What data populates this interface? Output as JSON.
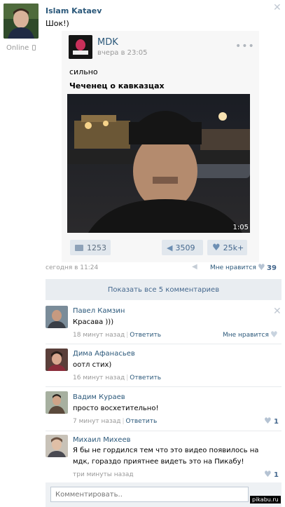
{
  "post": {
    "author": "Islam Kataev",
    "text": "Шок!)",
    "online_label": "Online",
    "date": "сегодня в 11:24",
    "like_label": "Мне нравится",
    "like_count": "39"
  },
  "repost": {
    "group_name": "MDK",
    "group_avatar_text": "MDK",
    "date": "вчера в 23:05",
    "text1": "сильно",
    "text2": "Чеченец о кавказцах",
    "video_duration": "1:05",
    "comments_count": "1253",
    "reposts_count": "3509",
    "likes_count": "25k+"
  },
  "show_all_comments": "Показать все 5 комментариев",
  "comments": [
    {
      "name": "Павел Камзин",
      "text": "Красава )))",
      "time": "18 минут назад",
      "reply": "Ответить",
      "like_label": "Мне нравится",
      "likes": ""
    },
    {
      "name": "Дима Афанасьев",
      "text": "оотл стих)",
      "time": "16 минут назад",
      "reply": "Ответить",
      "like_label": "",
      "likes": ""
    },
    {
      "name": "Вадим Кураев",
      "text": "просто восхетительно!",
      "time": "7 минут назад",
      "reply": "Ответить",
      "like_label": "",
      "likes": "1"
    },
    {
      "name": "Михаил Михеев",
      "text": "Я бы не гордился тем что это видео появилось на мдк, гораздо приятнее видеть это на Пикабу!",
      "time": "три минуты назад",
      "reply": "",
      "like_label": "",
      "likes": "1"
    }
  ],
  "comment_input": {
    "placeholder": "Комментировать.."
  },
  "watermark": "pikabu.ru",
  "colors": {
    "link": "#2b587a",
    "like": "#6d8fb3",
    "pill_bg": "#e1e7ed",
    "button_bg": "#e9edf1"
  }
}
